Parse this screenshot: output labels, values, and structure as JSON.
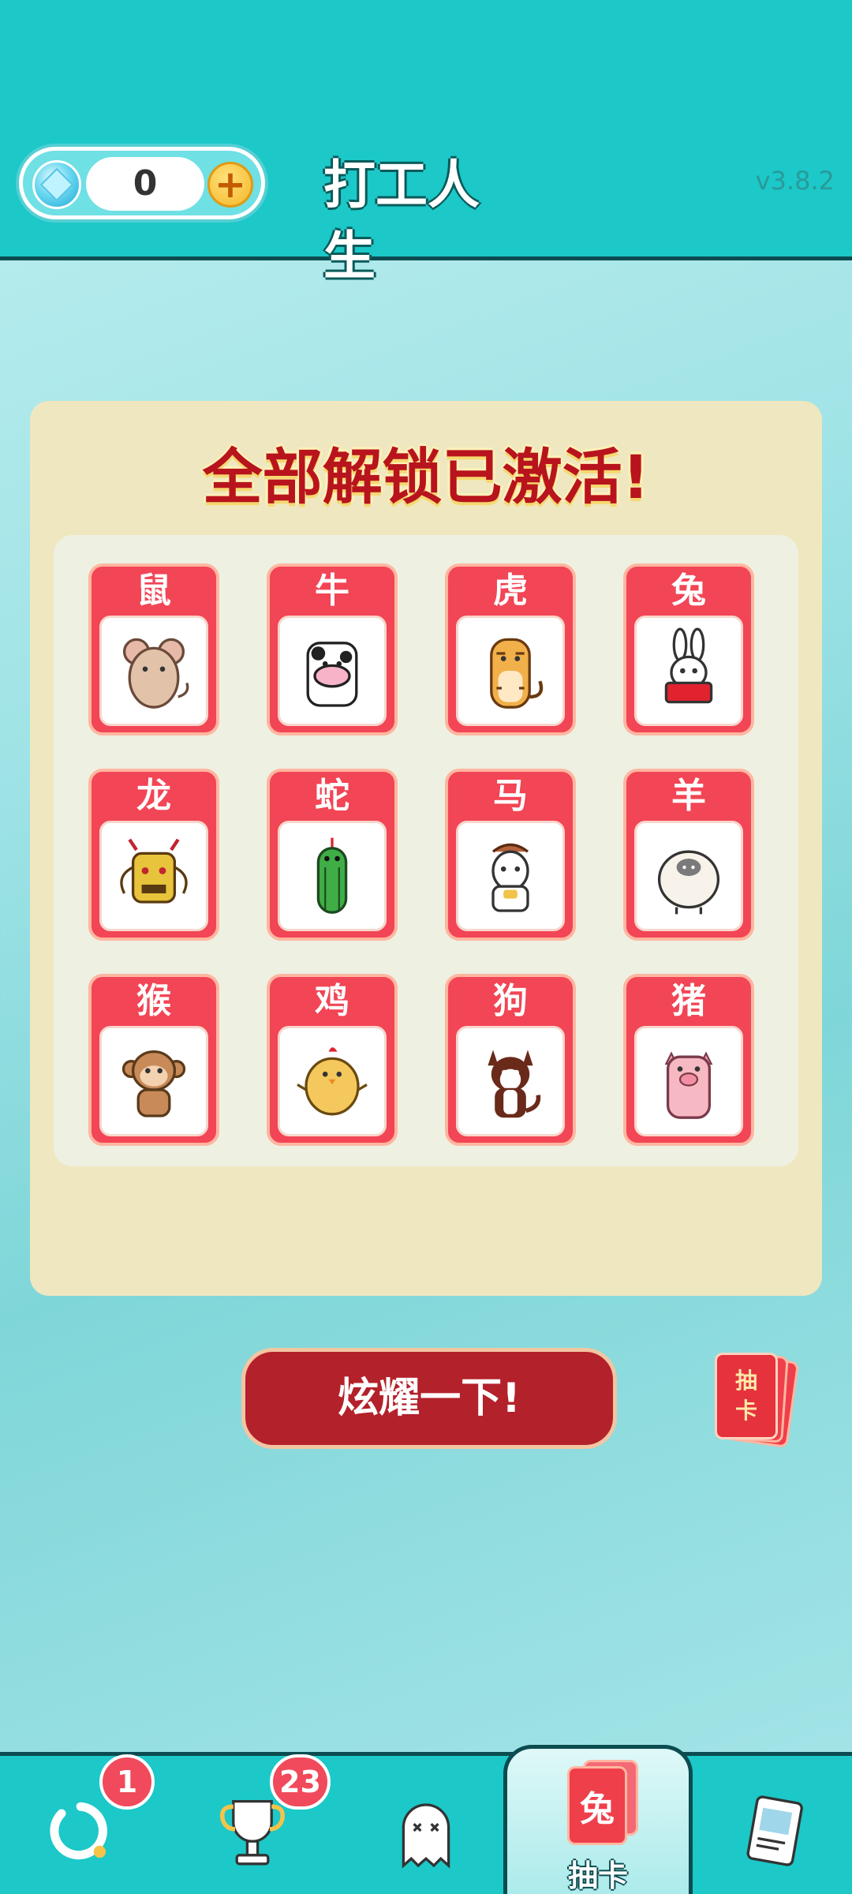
{
  "header": {
    "gem_count": "0",
    "plus_label": "+",
    "title": "打工人生",
    "version": "v3.8.2"
  },
  "panel": {
    "title": "全部解锁已激活!",
    "cards": [
      {
        "label": "鼠",
        "icon": "rat-icon"
      },
      {
        "label": "牛",
        "icon": "ox-icon"
      },
      {
        "label": "虎",
        "icon": "tiger-icon"
      },
      {
        "label": "兔",
        "icon": "rabbit-icon"
      },
      {
        "label": "龙",
        "icon": "dragon-icon"
      },
      {
        "label": "蛇",
        "icon": "snake-icon"
      },
      {
        "label": "马",
        "icon": "horse-icon"
      },
      {
        "label": "羊",
        "icon": "sheep-icon"
      },
      {
        "label": "猴",
        "icon": "monkey-icon"
      },
      {
        "label": "鸡",
        "icon": "chicken-icon"
      },
      {
        "label": "狗",
        "icon": "dog-icon"
      },
      {
        "label": "猪",
        "icon": "pig-icon"
      }
    ]
  },
  "actions": {
    "show_off_label": "炫耀一下!",
    "draw_card_line1": "抽",
    "draw_card_line2": "卡"
  },
  "nav": {
    "item1_badge": "1",
    "item2_badge": "23",
    "active_card_char": "兔",
    "active_label": "抽卡"
  },
  "colors": {
    "header_bg": "#1cc8c8",
    "card_red": "#f24555",
    "panel_bg": "#efe7c0",
    "button_red": "#b3212a"
  }
}
